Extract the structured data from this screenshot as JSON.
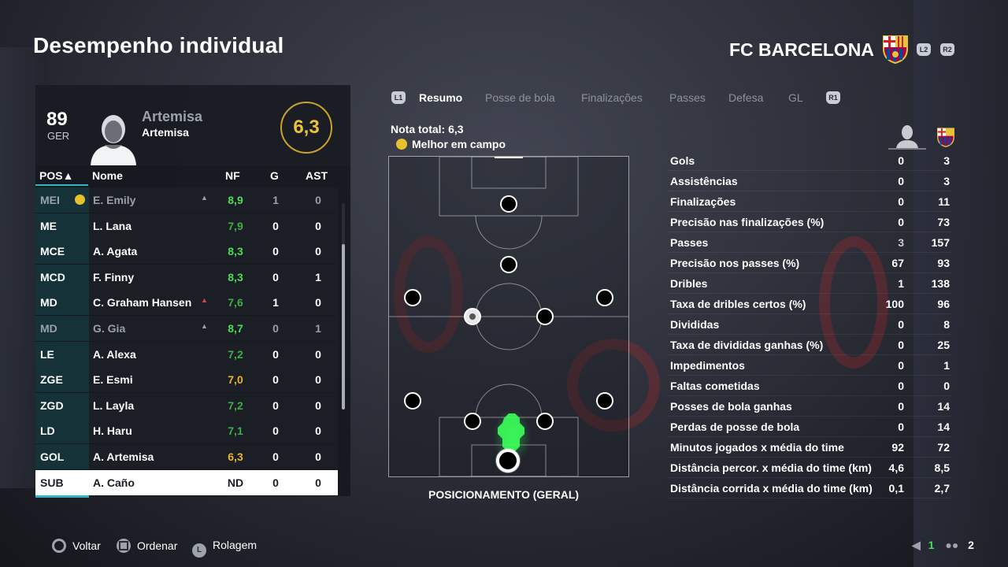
{
  "header": {
    "title": "Desempenho individual",
    "team_name": "FC BARCELONA",
    "btn_left": "L2",
    "btn_right": "R2"
  },
  "player": {
    "overall": "89",
    "overall_label": "GER",
    "name_primary": "Artemisa",
    "name_secondary": "Artemisa",
    "rating": "6,3"
  },
  "table": {
    "headers": {
      "pos": "POS▲",
      "name": "Nome",
      "nf": "NF",
      "g": "G",
      "ast": "AST"
    },
    "rows": [
      {
        "pos": "MEI",
        "name": "E. Emily",
        "nf": "8,9",
        "g": "1",
        "ast": "0",
        "motm": true,
        "arrow": true,
        "dim": true,
        "nf_color": "#4bdc55"
      },
      {
        "pos": "ME",
        "name": "L. Lana",
        "nf": "7,9",
        "g": "0",
        "ast": "0",
        "nf_color": "#3fae45"
      },
      {
        "pos": "MCE",
        "name": "A. Agata",
        "nf": "8,3",
        "g": "0",
        "ast": "0",
        "nf_color": "#4bdc55"
      },
      {
        "pos": "MCD",
        "name": "F. Finny",
        "nf": "8,3",
        "g": "0",
        "ast": "1",
        "nf_color": "#4bdc55"
      },
      {
        "pos": "MD",
        "name": "C. Graham Hansen",
        "nf": "7,6",
        "g": "1",
        "ast": "0",
        "arrow": true,
        "nf_color": "#3fae45"
      },
      {
        "pos": "MD",
        "name": "G. Gia",
        "nf": "8,7",
        "g": "0",
        "ast": "1",
        "arrow": true,
        "dim": true,
        "nf_color": "#4bdc55"
      },
      {
        "pos": "LE",
        "name": "A. Alexa",
        "nf": "7,2",
        "g": "0",
        "ast": "0",
        "nf_color": "#3fae45"
      },
      {
        "pos": "ZGE",
        "name": "E. Esmi",
        "nf": "7,0",
        "g": "0",
        "ast": "0",
        "nf_color": "#e8b52a"
      },
      {
        "pos": "ZGD",
        "name": "L. Layla",
        "nf": "7,2",
        "g": "0",
        "ast": "0",
        "nf_color": "#3fae45"
      },
      {
        "pos": "LD",
        "name": "H. Haru",
        "nf": "7,1",
        "g": "0",
        "ast": "0",
        "nf_color": "#3fae45"
      },
      {
        "pos": "GOL",
        "name": "A. Artemisa",
        "nf": "6,3",
        "g": "0",
        "ast": "0",
        "nf_color": "#e8b52a"
      },
      {
        "pos": "SUB",
        "name": "A. Caño",
        "nf": "ND",
        "g": "0",
        "ast": "0",
        "selected": true,
        "nf_color": "#1b1d24"
      }
    ]
  },
  "tabs": {
    "left_btn": "L1",
    "right_btn": "R1",
    "items": [
      "Resumo",
      "Posse de bola",
      "Finalizações",
      "Passes",
      "Defesa",
      "GL"
    ],
    "active_index": 0
  },
  "summary": {
    "total_label": "Nota total: 6,3",
    "motm_label": "Melhor em campo",
    "pitch_label": "POSICIONAMENTO (GERAL)"
  },
  "stats": [
    {
      "label": "Gols",
      "player": "0",
      "team": "3"
    },
    {
      "label": "Assistências",
      "player": "0",
      "team": "3"
    },
    {
      "label": "Finalizações",
      "player": "0",
      "team": "11"
    },
    {
      "label": "Precisão nas finalizações (%)",
      "player": "0",
      "team": "73"
    },
    {
      "label": "Passes",
      "player": "3",
      "team": "157",
      "muted": true
    },
    {
      "label": "Precisão nos passes (%)",
      "player": "67",
      "team": "93"
    },
    {
      "label": "Dribles",
      "player": "1",
      "team": "138"
    },
    {
      "label": "Taxa de dribles certos (%)",
      "player": "100",
      "team": "96"
    },
    {
      "label": "Divididas",
      "player": "0",
      "team": "8"
    },
    {
      "label": "Taxa de divididas ganhas (%)",
      "player": "0",
      "team": "25"
    },
    {
      "label": "Impedimentos",
      "player": "0",
      "team": "1"
    },
    {
      "label": "Faltas cometidas",
      "player": "0",
      "team": "0"
    },
    {
      "label": "Posses de bola ganhas",
      "player": "0",
      "team": "14"
    },
    {
      "label": "Perdas de posse de bola",
      "player": "0",
      "team": "14"
    },
    {
      "label": "Minutos jogados x média do time",
      "player": "92",
      "team": "72"
    },
    {
      "label": "Distância percor. x média do time (km)",
      "player": "4,6",
      "team": "8,5"
    },
    {
      "label": "Distância corrida x média do time (km)",
      "player": "0,1",
      "team": "2,7"
    }
  ],
  "footer": {
    "back": "Voltar",
    "sort": "Ordenar",
    "scroll": "Rolagem",
    "stick_letter": "L",
    "page_current": "1",
    "page_total": "2"
  },
  "colors": {
    "accent": "#2fb4c8",
    "rating_gold": "#e8c33a",
    "green": "#4bdc55",
    "team_red": "#a50044",
    "team_blue": "#004d98"
  }
}
